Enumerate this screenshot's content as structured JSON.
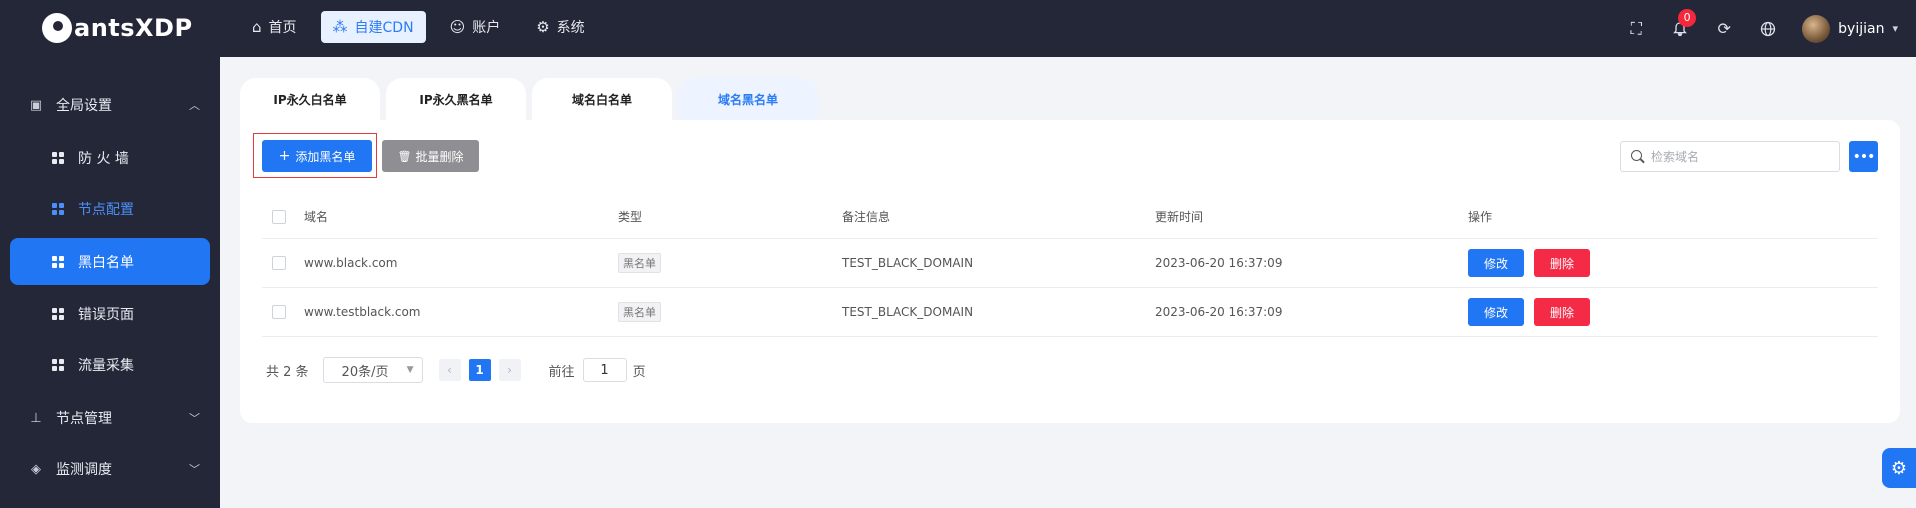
{
  "app": {
    "logo_text": "antsXDP"
  },
  "topnav": {
    "items": [
      {
        "label": "首页",
        "icon": "home-icon",
        "glyph": "⌂"
      },
      {
        "label": "自建CDN",
        "icon": "cdn-icon",
        "glyph": "⁂"
      },
      {
        "label": "账户",
        "icon": "user-icon",
        "glyph": "☺"
      },
      {
        "label": "系统",
        "icon": "gear-icon",
        "glyph": "⚙"
      }
    ],
    "notification_count": "0",
    "username": "byijian"
  },
  "sidebar": {
    "group_global": "全局设置",
    "items": [
      {
        "label": "防 火 墙"
      },
      {
        "label": "节点配置"
      },
      {
        "label": "黑白名单"
      },
      {
        "label": "错误页面"
      },
      {
        "label": "流量采集"
      }
    ],
    "group_node": "节点管理",
    "group_monitor": "监测调度"
  },
  "tabs": [
    "IP永久白名单",
    "IP永久黑名单",
    "域名白名单",
    "域名黑名单"
  ],
  "toolbar": {
    "add_label": "添加黑名单",
    "batch_delete_label": "批量删除",
    "search_placeholder": "检索域名"
  },
  "table": {
    "headers": {
      "domain": "域名",
      "type": "类型",
      "remark": "备注信息",
      "updated": "更新时间",
      "ops": "操作"
    },
    "rows": [
      {
        "domain": "www.black.com",
        "type": "黑名单",
        "remark": "TEST_BLACK_DOMAIN",
        "updated": "2023-06-20 16:37:09",
        "edit": "修改",
        "delete": "删除"
      },
      {
        "domain": "www.testblack.com",
        "type": "黑名单",
        "remark": "TEST_BLACK_DOMAIN",
        "updated": "2023-06-20 16:37:09",
        "edit": "修改",
        "delete": "删除"
      }
    ]
  },
  "pager": {
    "total": "共 2 条",
    "page_size": "20条/页",
    "current_page": "1",
    "goto_prefix": "前往",
    "goto_value": "1",
    "goto_suffix": "页"
  },
  "colors": {
    "primary": "#2176f4",
    "danger": "#f42a46",
    "sidebar_bg": "#232738"
  }
}
